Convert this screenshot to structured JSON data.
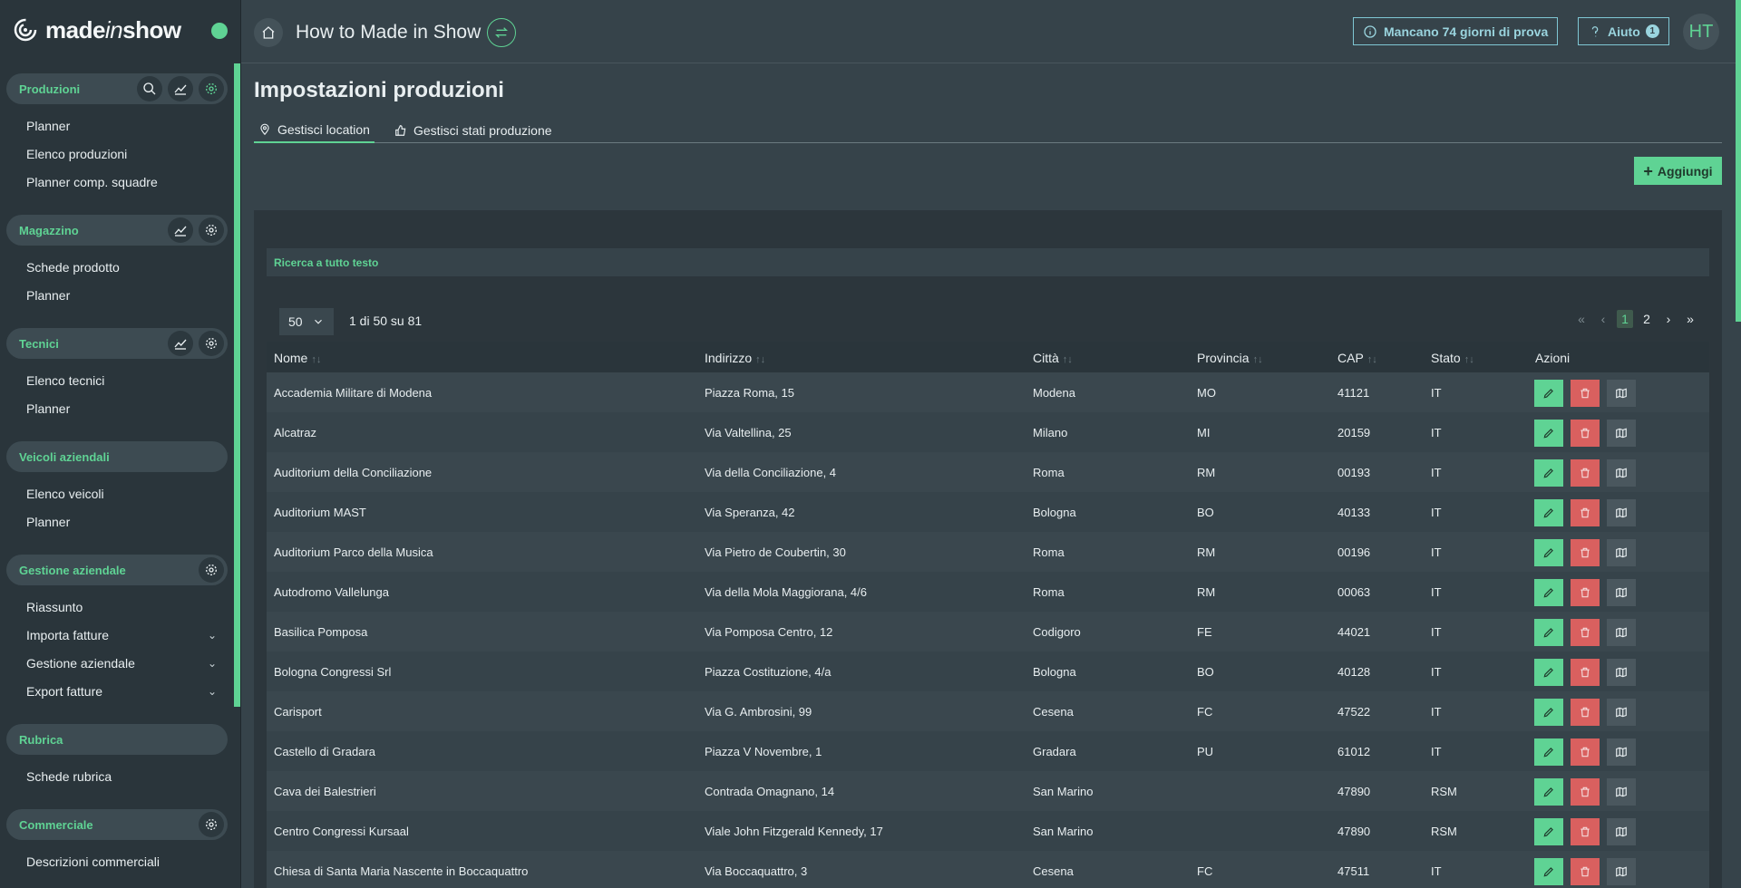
{
  "app": {
    "logo_text_1": "made",
    "logo_text_2": "in",
    "logo_text_3": "show",
    "title": "How to Made in Show",
    "trial": "Mancano 74 giorni di prova",
    "help": "Aiuto",
    "help_badge": "1",
    "avatar": "HT"
  },
  "sidebar": {
    "produzioni": {
      "title": "Produzioni",
      "items": [
        "Planner",
        "Elenco produzioni",
        "Planner comp. squadre"
      ]
    },
    "magazzino": {
      "title": "Magazzino",
      "items": [
        "Schede prodotto",
        "Planner"
      ]
    },
    "tecnici": {
      "title": "Tecnici",
      "items": [
        "Elenco tecnici",
        "Planner"
      ]
    },
    "veicoli": {
      "title": "Veicoli aziendali",
      "items": [
        "Elenco veicoli",
        "Planner"
      ]
    },
    "gestione": {
      "title": "Gestione aziendale",
      "items": [
        "Riassunto",
        "Importa fatture",
        "Gestione aziendale",
        "Export fatture"
      ]
    },
    "rubrica": {
      "title": "Rubrica",
      "items": [
        "Schede rubrica"
      ]
    },
    "commerciale": {
      "title": "Commerciale",
      "items": [
        "Descrizioni commerciali"
      ]
    }
  },
  "main": {
    "page_title": "Impostazioni produzioni",
    "tabs": [
      "Gestisci location",
      "Gestisci stati produzione"
    ],
    "add_label": "Aggiungi",
    "search_label": "Ricerca a tutto testo",
    "per_page": "50",
    "count": "1 di 50 su 81",
    "pages": [
      "1",
      "2"
    ]
  },
  "table": {
    "headers": [
      "Nome",
      "Indirizzo",
      "Città",
      "Provincia",
      "CAP",
      "Stato",
      "Azioni"
    ],
    "rows": [
      [
        "Accademia Militare di Modena",
        "Piazza Roma, 15",
        "Modena",
        "MO",
        "41121",
        "IT"
      ],
      [
        "Alcatraz",
        "Via Valtellina, 25",
        "Milano",
        "MI",
        "20159",
        "IT"
      ],
      [
        "Auditorium della Conciliazione",
        "Via della Conciliazione, 4",
        "Roma",
        "RM",
        "00193",
        "IT"
      ],
      [
        "Auditorium MAST",
        "Via Speranza, 42",
        "Bologna",
        "BO",
        "40133",
        "IT"
      ],
      [
        "Auditorium Parco della Musica",
        "Via Pietro de Coubertin, 30",
        "Roma",
        "RM",
        "00196",
        "IT"
      ],
      [
        "Autodromo Vallelunga",
        "Via della Mola Maggiorana, 4/6",
        "Roma",
        "RM",
        "00063",
        "IT"
      ],
      [
        "Basilica Pomposa",
        "Via Pomposa Centro, 12",
        "Codigoro",
        "FE",
        "44021",
        "IT"
      ],
      [
        "Bologna Congressi Srl",
        "Piazza Costituzione, 4/a",
        "Bologna",
        "BO",
        "40128",
        "IT"
      ],
      [
        "Carisport",
        "Via G. Ambrosini, 99",
        "Cesena",
        "FC",
        "47522",
        "IT"
      ],
      [
        "Castello di Gradara",
        "Piazza V Novembre, 1",
        "Gradara",
        "PU",
        "61012",
        "IT"
      ],
      [
        "Cava dei Balestrieri",
        "Contrada Omagnano, 14",
        "San Marino",
        "",
        "47890",
        "RSM"
      ],
      [
        "Centro Congressi Kursaal",
        "Viale John Fitzgerald Kennedy, 17",
        "San Marino",
        "",
        "47890",
        "RSM"
      ],
      [
        "Chiesa di Santa Maria Nascente in Boccaquattro",
        "Via Boccaquattro, 3",
        "Cesena",
        "FC",
        "47511",
        "IT"
      ]
    ]
  }
}
